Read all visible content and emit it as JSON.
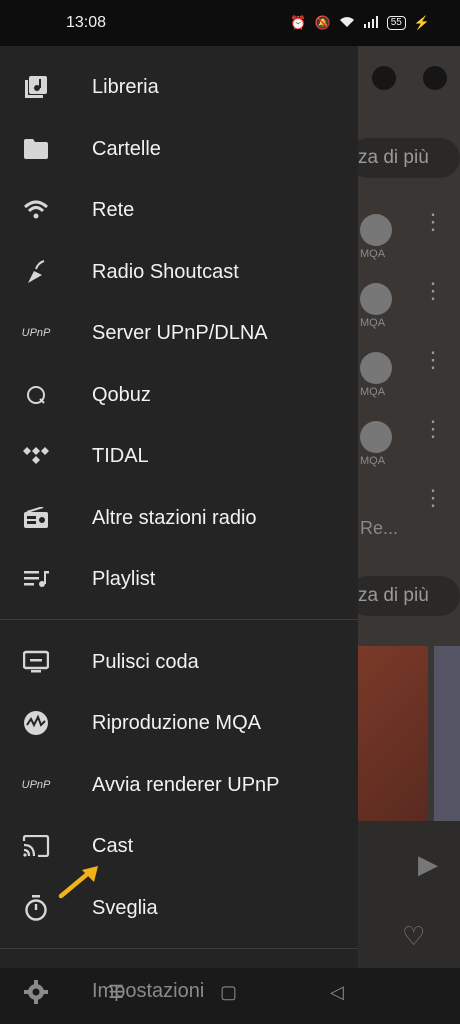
{
  "status": {
    "time": "13:08",
    "battery": "55"
  },
  "menu": {
    "items": [
      {
        "label": "Libreria",
        "icon": "library-music-icon"
      },
      {
        "label": "Cartelle",
        "icon": "folder-icon"
      },
      {
        "label": "Rete",
        "icon": "wifi-icon"
      },
      {
        "label": "Radio Shoutcast",
        "icon": "shoutcast-icon"
      },
      {
        "label": "Server UPnP/DLNA",
        "icon": "upnp-icon"
      },
      {
        "label": "Qobuz",
        "icon": "qobuz-icon"
      },
      {
        "label": "TIDAL",
        "icon": "tidal-icon"
      },
      {
        "label": "Altre stazioni radio",
        "icon": "radio-icon"
      },
      {
        "label": "Playlist",
        "icon": "playlist-icon"
      }
    ],
    "actions": [
      {
        "label": "Pulisci coda",
        "icon": "clear-queue-icon"
      },
      {
        "label": "Riproduzione MQA",
        "icon": "mqa-icon"
      },
      {
        "label": "Avvia renderer UPnP",
        "icon": "upnp-icon"
      },
      {
        "label": "Cast",
        "icon": "cast-icon"
      },
      {
        "label": "Sveglia",
        "icon": "timer-icon"
      }
    ],
    "settings": {
      "label": "Impostazioni",
      "icon": "gear-icon"
    },
    "upnp_text": "UPnP"
  },
  "background": {
    "more_label": "za di più",
    "mqa_label": "MQA",
    "partial_text": "Re..."
  },
  "colors": {
    "accent": "#f2b21a",
    "drawer": "#242424"
  }
}
